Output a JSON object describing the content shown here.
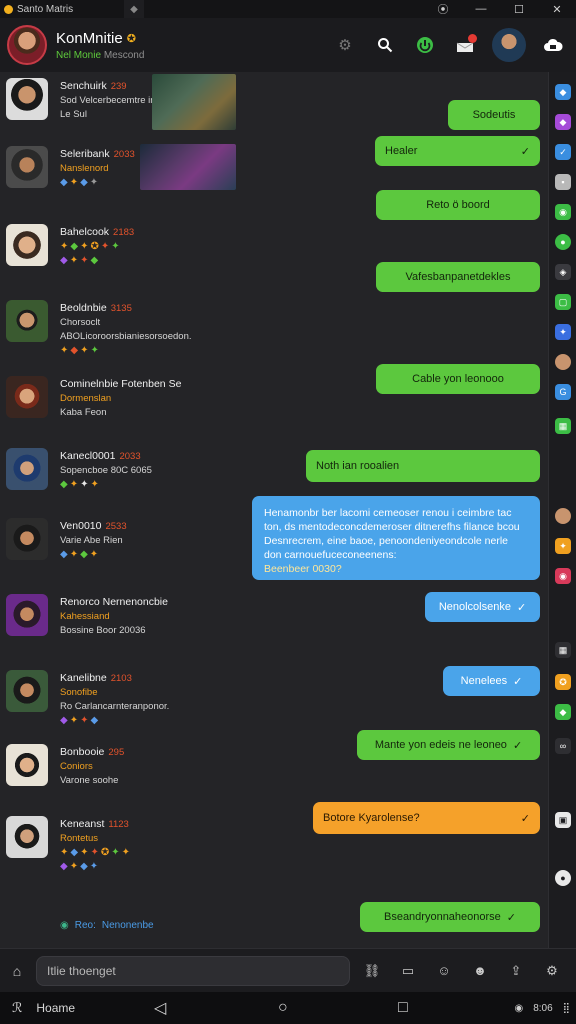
{
  "titlebar": {
    "app_title": "Santo Matris",
    "controls": [
      "⦿",
      "—",
      "☐",
      "✕"
    ]
  },
  "header": {
    "title": "KonMnitie",
    "subtitle_highlight": "Nel Monie",
    "subtitle_rest": "Mescond"
  },
  "messages_left": [
    {
      "name": "Senchuirk",
      "level": "239",
      "line1": "Sod  Velcerbecemtre in biclos",
      "line2": "Le  Sul"
    },
    {
      "name": "Seleribank",
      "level": "2033",
      "line1": "Nanslenord",
      "line2": ""
    },
    {
      "name": "Bahelcook",
      "level": "2183",
      "line1": "",
      "line2": ""
    },
    {
      "name": "Beoldnbie",
      "level": "3135",
      "line1": "Chorsoclt",
      "line2": "ABOLicoroorsbianiesorsoedon."
    },
    {
      "name": "Cominelnbie Fotenben Se",
      "level": "",
      "line1": "Dormenslan",
      "line2": "Kaba Feon"
    },
    {
      "name": "Kanecl0001",
      "level": "2033",
      "line1": "Sopencboe 80C 6065",
      "line2": ""
    },
    {
      "name": "Ven0010",
      "level": "2533",
      "line1": "Varie Abe Rien",
      "line2": ""
    },
    {
      "name": "Renorco Nernenoncbie",
      "level": "",
      "line1": "Kahessiand",
      "line2": "Bossine Boor 20036"
    },
    {
      "name": "Kanelibne",
      "level": "2103",
      "line1": "Sonofibe",
      "line2": "Ro Carlancarnteranponor."
    },
    {
      "name": "Bonbooie",
      "level": "295",
      "line1": "Coniors",
      "line2": "Varone soohe"
    },
    {
      "name": "Keneanst",
      "level": "1123",
      "line1": "Rontetus",
      "line2": ""
    }
  ],
  "messages_right": [
    {
      "text": "Sodeutis"
    },
    {
      "text": "Healer"
    },
    {
      "text": "Reto ö boord"
    },
    {
      "text": "Vafesbanpanetdekles"
    },
    {
      "text": "Cable yon leonooo"
    },
    {
      "text": "Noth ian rooalien"
    },
    {
      "line1": "Henamonbr ber lacomi cemeoser renou i ceimbre tac",
      "line2": "ton, ds mentodeconcdemeroser ditnerefhs filance bcou",
      "line3": "Desnrecrem, eine baoe, penoondeniyeondcole nerle",
      "line4": "don carnouefuceconeenens:",
      "meta": "Beenbeer 0030?"
    },
    {
      "text": "Nenolcolsenke"
    },
    {
      "text": "Nenelees"
    },
    {
      "text": "Mante yon edeis ne leoneo"
    },
    {
      "text": "Botore Kyarolense?"
    },
    {
      "text": "Bseandryonnaheonorse"
    }
  ],
  "typing": {
    "text": "Reo:",
    "name": "Nenonenbe"
  },
  "composer": {
    "placeholder": "Itlie thoenget"
  },
  "navbar": {
    "label": "Hoame",
    "clock": "8:06"
  },
  "colors": {
    "green_bubble": "#5cc83e",
    "blue_bubble": "#4aa4ea",
    "orange_bubble": "#f5a12a",
    "background": "#242427",
    "level": "#e2532c"
  }
}
